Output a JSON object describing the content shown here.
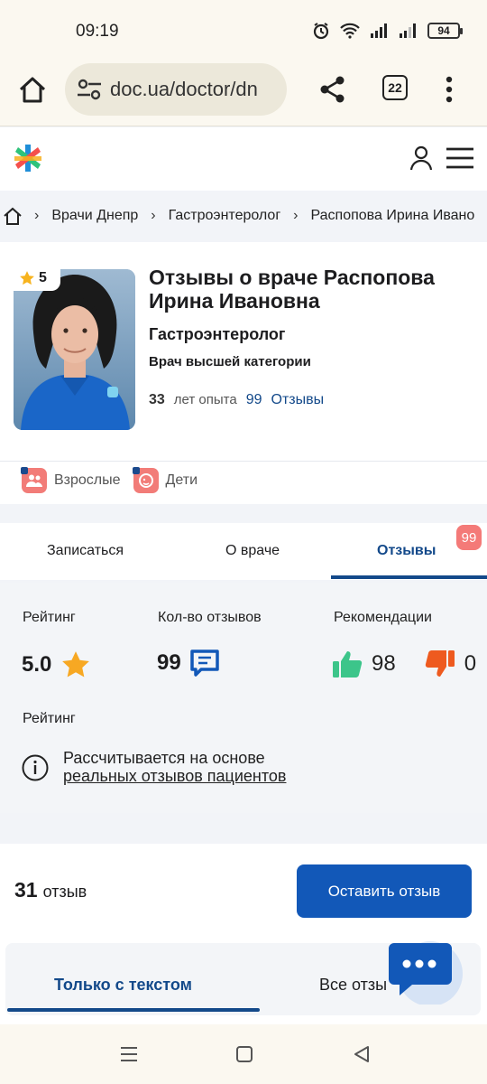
{
  "status_bar": {
    "time": "09:19",
    "battery": "94"
  },
  "browser": {
    "url": "doc.ua/doctor/dn",
    "tab_count": "22"
  },
  "breadcrumb": {
    "items": [
      "Врачи Днепр",
      "Гастроэнтеролог",
      "Распопова Ирина Ивано"
    ]
  },
  "doctor": {
    "rating": "5",
    "title": "Отзывы о враче Распопова Ирина Ивановна",
    "specialty": "Гастроэнтеролог",
    "category": "Врач высшей категории",
    "experience_years": "33",
    "experience_label": "лет опыта",
    "reviews_count": "99",
    "reviews_label": "Отзывы",
    "tags": [
      "Взрослые",
      "Дети"
    ]
  },
  "tabs": {
    "items": [
      "Записаться",
      "О враче",
      "Отзывы"
    ],
    "active": "Отзывы",
    "badge": "99"
  },
  "stats": {
    "rating_label": "Рейтинг",
    "rating_value": "5.0",
    "count_label": "Кол-во отзывов",
    "count_value": "99",
    "recommend_label": "Рекомендации",
    "likes": "98",
    "dislikes": "0",
    "rating_sub": "Рейтинг",
    "info_line1": "Рассчитывается на основе",
    "info_link": "реальных отзывов пациентов"
  },
  "reviews": {
    "count": "31",
    "count_word": "отзыв",
    "leave_button": "Оставить отзыв",
    "filter_active": "Только с текстом",
    "filter_other": "Все отзы"
  },
  "colors": {
    "accent": "#13498a",
    "button": "#1258b8",
    "badge": "#f47a78",
    "like": "#3cc58a",
    "dislike": "#ee5a1f",
    "star": "#f7a823"
  }
}
